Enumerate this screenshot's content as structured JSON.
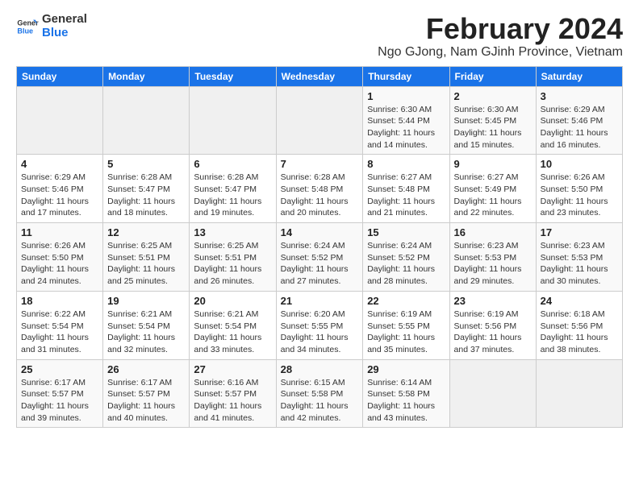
{
  "app": {
    "name": "GeneralBlue",
    "logo_text_1": "General",
    "logo_text_2": "Blue"
  },
  "header": {
    "title": "February 2024",
    "subtitle": "Ngo GJong, Nam GJinh Province, Vietnam"
  },
  "calendar": {
    "days_of_week": [
      "Sunday",
      "Monday",
      "Tuesday",
      "Wednesday",
      "Thursday",
      "Friday",
      "Saturday"
    ],
    "weeks": [
      [
        {
          "day": "",
          "info": ""
        },
        {
          "day": "",
          "info": ""
        },
        {
          "day": "",
          "info": ""
        },
        {
          "day": "",
          "info": ""
        },
        {
          "day": "1",
          "info": "Sunrise: 6:30 AM\nSunset: 5:44 PM\nDaylight: 11 hours and 14 minutes."
        },
        {
          "day": "2",
          "info": "Sunrise: 6:30 AM\nSunset: 5:45 PM\nDaylight: 11 hours and 15 minutes."
        },
        {
          "day": "3",
          "info": "Sunrise: 6:29 AM\nSunset: 5:46 PM\nDaylight: 11 hours and 16 minutes."
        }
      ],
      [
        {
          "day": "4",
          "info": "Sunrise: 6:29 AM\nSunset: 5:46 PM\nDaylight: 11 hours and 17 minutes."
        },
        {
          "day": "5",
          "info": "Sunrise: 6:28 AM\nSunset: 5:47 PM\nDaylight: 11 hours and 18 minutes."
        },
        {
          "day": "6",
          "info": "Sunrise: 6:28 AM\nSunset: 5:47 PM\nDaylight: 11 hours and 19 minutes."
        },
        {
          "day": "7",
          "info": "Sunrise: 6:28 AM\nSunset: 5:48 PM\nDaylight: 11 hours and 20 minutes."
        },
        {
          "day": "8",
          "info": "Sunrise: 6:27 AM\nSunset: 5:48 PM\nDaylight: 11 hours and 21 minutes."
        },
        {
          "day": "9",
          "info": "Sunrise: 6:27 AM\nSunset: 5:49 PM\nDaylight: 11 hours and 22 minutes."
        },
        {
          "day": "10",
          "info": "Sunrise: 6:26 AM\nSunset: 5:50 PM\nDaylight: 11 hours and 23 minutes."
        }
      ],
      [
        {
          "day": "11",
          "info": "Sunrise: 6:26 AM\nSunset: 5:50 PM\nDaylight: 11 hours and 24 minutes."
        },
        {
          "day": "12",
          "info": "Sunrise: 6:25 AM\nSunset: 5:51 PM\nDaylight: 11 hours and 25 minutes."
        },
        {
          "day": "13",
          "info": "Sunrise: 6:25 AM\nSunset: 5:51 PM\nDaylight: 11 hours and 26 minutes."
        },
        {
          "day": "14",
          "info": "Sunrise: 6:24 AM\nSunset: 5:52 PM\nDaylight: 11 hours and 27 minutes."
        },
        {
          "day": "15",
          "info": "Sunrise: 6:24 AM\nSunset: 5:52 PM\nDaylight: 11 hours and 28 minutes."
        },
        {
          "day": "16",
          "info": "Sunrise: 6:23 AM\nSunset: 5:53 PM\nDaylight: 11 hours and 29 minutes."
        },
        {
          "day": "17",
          "info": "Sunrise: 6:23 AM\nSunset: 5:53 PM\nDaylight: 11 hours and 30 minutes."
        }
      ],
      [
        {
          "day": "18",
          "info": "Sunrise: 6:22 AM\nSunset: 5:54 PM\nDaylight: 11 hours and 31 minutes."
        },
        {
          "day": "19",
          "info": "Sunrise: 6:21 AM\nSunset: 5:54 PM\nDaylight: 11 hours and 32 minutes."
        },
        {
          "day": "20",
          "info": "Sunrise: 6:21 AM\nSunset: 5:54 PM\nDaylight: 11 hours and 33 minutes."
        },
        {
          "day": "21",
          "info": "Sunrise: 6:20 AM\nSunset: 5:55 PM\nDaylight: 11 hours and 34 minutes."
        },
        {
          "day": "22",
          "info": "Sunrise: 6:19 AM\nSunset: 5:55 PM\nDaylight: 11 hours and 35 minutes."
        },
        {
          "day": "23",
          "info": "Sunrise: 6:19 AM\nSunset: 5:56 PM\nDaylight: 11 hours and 37 minutes."
        },
        {
          "day": "24",
          "info": "Sunrise: 6:18 AM\nSunset: 5:56 PM\nDaylight: 11 hours and 38 minutes."
        }
      ],
      [
        {
          "day": "25",
          "info": "Sunrise: 6:17 AM\nSunset: 5:57 PM\nDaylight: 11 hours and 39 minutes."
        },
        {
          "day": "26",
          "info": "Sunrise: 6:17 AM\nSunset: 5:57 PM\nDaylight: 11 hours and 40 minutes."
        },
        {
          "day": "27",
          "info": "Sunrise: 6:16 AM\nSunset: 5:57 PM\nDaylight: 11 hours and 41 minutes."
        },
        {
          "day": "28",
          "info": "Sunrise: 6:15 AM\nSunset: 5:58 PM\nDaylight: 11 hours and 42 minutes."
        },
        {
          "day": "29",
          "info": "Sunrise: 6:14 AM\nSunset: 5:58 PM\nDaylight: 11 hours and 43 minutes."
        },
        {
          "day": "",
          "info": ""
        },
        {
          "day": "",
          "info": ""
        }
      ]
    ]
  }
}
